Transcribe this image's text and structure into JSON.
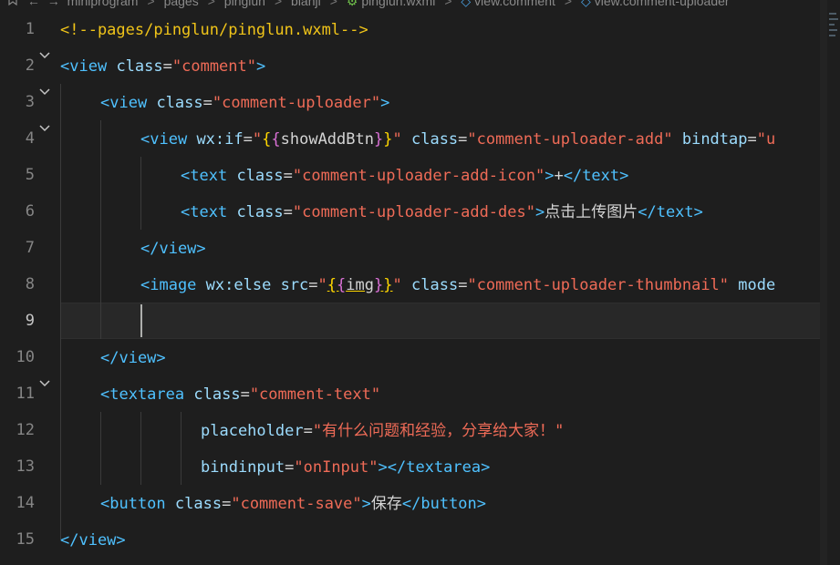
{
  "breadcrumb": {
    "items": [
      "miniprogram",
      "pages",
      "pinglun",
      "bianji",
      "pinglun.wxml",
      "view.comment",
      "view.comment-uploader"
    ],
    "separator": ">"
  },
  "editor": {
    "current_line": 9,
    "line_numbers": [
      "1",
      "2",
      "3",
      "4",
      "5",
      "6",
      "7",
      "8",
      "9",
      "10",
      "11",
      "12",
      "13",
      "14",
      "15"
    ],
    "lines": [
      [
        {
          "t": "com",
          "v": "<!--pages/pinglun/pinglun.wxml-->"
        }
      ],
      [
        {
          "t": "tag",
          "v": "<view"
        },
        {
          "t": "txt",
          "v": " "
        },
        {
          "t": "attr",
          "v": "class"
        },
        {
          "t": "txt",
          "v": "="
        },
        {
          "t": "str",
          "v": "\"comment\""
        },
        {
          "t": "tag",
          "v": ">"
        }
      ],
      [
        {
          "t": "tag",
          "v": "<view"
        },
        {
          "t": "txt",
          "v": " "
        },
        {
          "t": "attr",
          "v": "class"
        },
        {
          "t": "txt",
          "v": "="
        },
        {
          "t": "str",
          "v": "\"comment-uploader\""
        },
        {
          "t": "tag",
          "v": ">"
        }
      ],
      [
        {
          "t": "tag",
          "v": "<view"
        },
        {
          "t": "txt",
          "v": " "
        },
        {
          "t": "attr",
          "v": "wx:if"
        },
        {
          "t": "txt",
          "v": "="
        },
        {
          "t": "str",
          "v": "\""
        },
        {
          "t": "br1",
          "v": "{"
        },
        {
          "t": "br2",
          "v": "{"
        },
        {
          "t": "var",
          "v": "showAddBtn"
        },
        {
          "t": "br2",
          "v": "}"
        },
        {
          "t": "br1",
          "v": "}"
        },
        {
          "t": "str",
          "v": "\""
        },
        {
          "t": "txt",
          "v": " "
        },
        {
          "t": "attr",
          "v": "class"
        },
        {
          "t": "txt",
          "v": "="
        },
        {
          "t": "str",
          "v": "\"comment-uploader-add\""
        },
        {
          "t": "txt",
          "v": " "
        },
        {
          "t": "attr",
          "v": "bindtap"
        },
        {
          "t": "txt",
          "v": "="
        },
        {
          "t": "str",
          "v": "\"u"
        }
      ],
      [
        {
          "t": "tag",
          "v": "<text"
        },
        {
          "t": "txt",
          "v": " "
        },
        {
          "t": "attr",
          "v": "class"
        },
        {
          "t": "txt",
          "v": "="
        },
        {
          "t": "str",
          "v": "\"comment-uploader-add-icon\""
        },
        {
          "t": "tag",
          "v": ">"
        },
        {
          "t": "txt",
          "v": "+"
        },
        {
          "t": "tag",
          "v": "</text>"
        }
      ],
      [
        {
          "t": "tag",
          "v": "<text"
        },
        {
          "t": "txt",
          "v": " "
        },
        {
          "t": "attr",
          "v": "class"
        },
        {
          "t": "txt",
          "v": "="
        },
        {
          "t": "str",
          "v": "\"comment-uploader-add-des\""
        },
        {
          "t": "tag",
          "v": ">"
        },
        {
          "t": "txt",
          "v": "点击上传图片"
        },
        {
          "t": "tag",
          "v": "</text>"
        }
      ],
      [
        {
          "t": "tag",
          "v": "</view>"
        }
      ],
      [
        {
          "t": "tag",
          "v": "<image"
        },
        {
          "t": "txt",
          "v": " "
        },
        {
          "t": "attr",
          "v": "wx:else"
        },
        {
          "t": "txt",
          "v": " "
        },
        {
          "t": "attr",
          "v": "src"
        },
        {
          "t": "txt",
          "v": "="
        },
        {
          "t": "str",
          "v": "\""
        },
        {
          "t": "br1",
          "v": "{"
        },
        {
          "t": "br2",
          "v": "{"
        },
        {
          "t": "var",
          "v": "img"
        },
        {
          "t": "br2",
          "v": "}"
        },
        {
          "t": "br1",
          "v": "}"
        },
        {
          "t": "str",
          "v": "\""
        },
        {
          "t": "txt",
          "v": " "
        },
        {
          "t": "attr",
          "v": "class"
        },
        {
          "t": "txt",
          "v": "="
        },
        {
          "t": "str",
          "v": "\"comment-uploader-thumbnail\""
        },
        {
          "t": "txt",
          "v": " "
        },
        {
          "t": "attr",
          "v": "mode"
        }
      ],
      [],
      [
        {
          "t": "tag",
          "v": "</view>"
        }
      ],
      [
        {
          "t": "tag",
          "v": "<textarea"
        },
        {
          "t": "txt",
          "v": " "
        },
        {
          "t": "attr",
          "v": "class"
        },
        {
          "t": "txt",
          "v": "="
        },
        {
          "t": "str",
          "v": "\"comment-text\""
        }
      ],
      [
        {
          "t": "attr",
          "v": "placeholder"
        },
        {
          "t": "txt",
          "v": "="
        },
        {
          "t": "str",
          "v": "\"有什么问题和经验，分享给大家！\""
        }
      ],
      [
        {
          "t": "attr",
          "v": "bindinput"
        },
        {
          "t": "txt",
          "v": "="
        },
        {
          "t": "str",
          "v": "\"onInput\""
        },
        {
          "t": "tag",
          "v": "></textarea>"
        }
      ],
      [
        {
          "t": "tag",
          "v": "<button"
        },
        {
          "t": "txt",
          "v": " "
        },
        {
          "t": "attr",
          "v": "class"
        },
        {
          "t": "txt",
          "v": "="
        },
        {
          "t": "str",
          "v": "\"comment-save\""
        },
        {
          "t": "tag",
          "v": ">"
        },
        {
          "t": "txt",
          "v": "保存"
        },
        {
          "t": "tag",
          "v": "</button>"
        }
      ],
      [
        {
          "t": "tag",
          "v": "</view>"
        }
      ]
    ]
  },
  "colors": {
    "background": "#1e1e1e",
    "tag": "#4fc1ff",
    "attribute": "#9cdcfe",
    "string": "#ef6b57",
    "comment": "#f0c419",
    "text": "#d4d4d4"
  },
  "icons": [
    "bookmark-icon",
    "back-arrow-icon",
    "forward-arrow-icon",
    "fold-chevron-icon",
    "file-icon",
    "cube-icon"
  ]
}
